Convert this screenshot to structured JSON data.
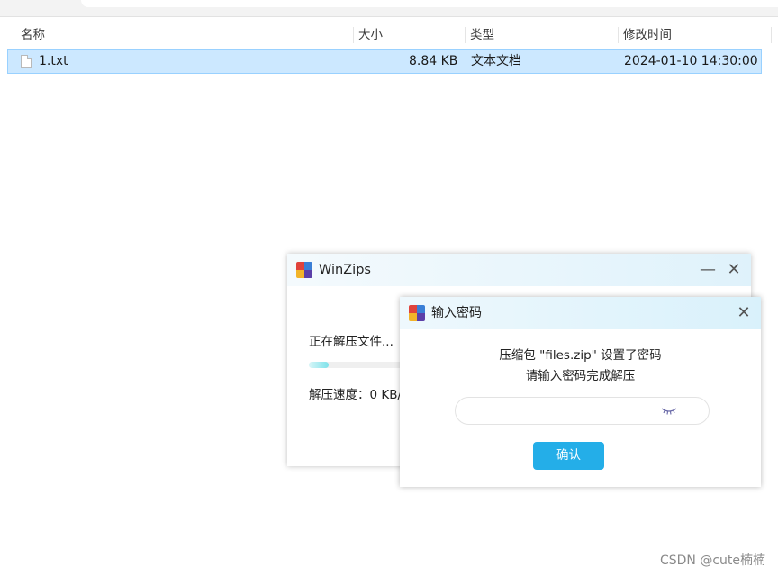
{
  "explorer": {
    "columns": {
      "name": "名称",
      "size": "大小",
      "type": "类型",
      "modified": "修改时间"
    },
    "files": [
      {
        "name": "1.txt",
        "size": "8.84 KB",
        "type": "文本文档",
        "modified": "2024-01-10 14:30:00",
        "icon": "text-file-icon",
        "selected": true
      }
    ]
  },
  "winzips": {
    "title": "WinZips",
    "status": "正在解压文件...",
    "progress": 0.11,
    "speed": "解压速度：0 KB/",
    "colors": {
      "progress_fill": "#7ee2ea",
      "titlebar": "#dff2fb"
    }
  },
  "password_dialog": {
    "title": "输入密码",
    "message_line1": "压缩包 \"files.zip\" 设置了密码",
    "message_line2": "请输入密码完成解压",
    "password_value": "",
    "confirm_label": "确认",
    "colors": {
      "confirm_button": "#24aee8"
    }
  },
  "watermark": "CSDN @cute楠楠"
}
